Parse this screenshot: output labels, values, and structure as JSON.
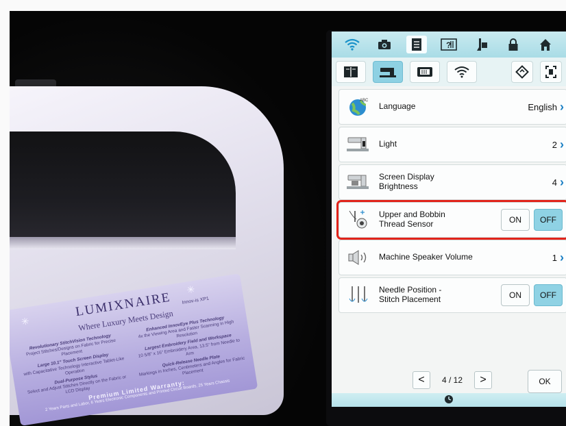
{
  "decal": {
    "brand": "LUMIXNAIRE",
    "model": "Innov-is XP1",
    "tagline": "Where Luxury Meets Design",
    "left_col": [
      {
        "title": "Revolutionary StitchVision Technology",
        "text": "Project Stitches/Designs on Fabric for Precise Placement"
      },
      {
        "title": "Large 10.1\" Touch Screen Display",
        "text": "with Capacitative Technology Interactive Tablet-Like Operation"
      },
      {
        "title": "Dual-Purpose Stylus",
        "text": "Select and Adjust Stitches Directly on the Fabric or LCD Display"
      }
    ],
    "right_col": [
      {
        "title": "Enhanced InnovEye Plus Technology",
        "text": "4x the Viewing Area and Faster Scanning in High Resolution"
      },
      {
        "title": "Largest Embroidery Field and Workspace",
        "text": "10 5/8\" x 16\" Embroidery Area, 13.5\" from Needle to Arm"
      },
      {
        "title": "Quick-Release Needle Plate",
        "text": "Markings in Inches, Centimeters and Angles for Fabric Placement"
      }
    ],
    "warranty": "Premium Limited Warranty:",
    "warranty_detail": "2 Years Parts and Labor, 6 Years Electronic Components and Printed Circuit Boards, 25 Years Chassis"
  },
  "topbar": {
    "icons": [
      "wifi-icon",
      "camera-icon",
      "document-icon",
      "help-icon",
      "stylus-icon",
      "lock-icon",
      "home-icon"
    ]
  },
  "tabs": {
    "items": [
      "book-icon",
      "sewing-machine-icon",
      "embroidery-frame-icon",
      "wifi-icon"
    ],
    "active_index": 1,
    "right_icons": [
      "rotate-icon",
      "fullscreen-icon"
    ]
  },
  "settings": [
    {
      "label": "Language",
      "value": "English",
      "control": "chevron",
      "icon": "globe-icon"
    },
    {
      "label": "Light",
      "value": "2",
      "control": "chevron",
      "icon": "machine-light-icon"
    },
    {
      "label": "Screen Display\nBrightness",
      "value": "4",
      "control": "chevron",
      "icon": "machine-screen-icon"
    },
    {
      "label": "Upper and Bobbin\nThread Sensor",
      "on": "ON",
      "off": "OFF",
      "control": "toggle",
      "selected": "OFF",
      "icon": "thread-sensor-icon",
      "highlighted": true
    },
    {
      "label": "Machine Speaker Volume",
      "value": "1",
      "control": "chevron",
      "icon": "speaker-icon"
    },
    {
      "label": "Needle Position -\nStitch Placement",
      "on": "ON",
      "off": "OFF",
      "control": "toggle",
      "selected": "OFF",
      "icon": "needles-icon"
    }
  ],
  "pager": {
    "text": "4 / 12",
    "prev": "<",
    "next": ">"
  },
  "ok_label": "OK",
  "colors": {
    "accent": "#8ed1e3",
    "highlight": "#e2231a",
    "chevron": "#1a7fc4"
  }
}
